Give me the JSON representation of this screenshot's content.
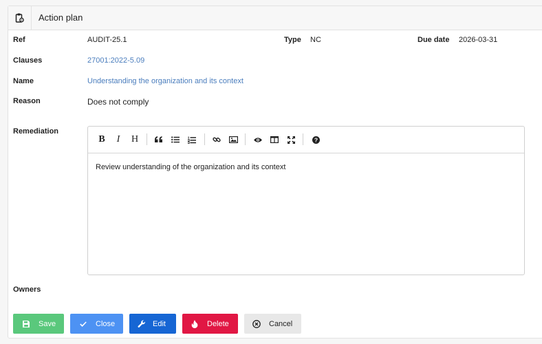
{
  "header": {
    "title": "Action plan",
    "icon": "clipboard-gear-icon"
  },
  "fields": {
    "ref_label": "Ref",
    "ref_value": "AUDIT-25.1",
    "type_label": "Type",
    "type_value": "NC",
    "due_label": "Due date",
    "due_value": "2026-03-31",
    "clauses_label": "Clauses",
    "clauses_value": "27001:2022-5.09",
    "name_label": "Name",
    "name_value": "Understanding the organization and its context",
    "reason_label": "Reason",
    "reason_value": "Does not comply",
    "remediation_label": "Remediation",
    "owners_label": "Owners"
  },
  "editor": {
    "content": "Review understanding of the organization and its context",
    "toolbar": {
      "bold": "B",
      "italic": "I",
      "heading": "H",
      "icons": [
        "quote-icon",
        "unordered-list-icon",
        "ordered-list-icon",
        "link-icon",
        "image-icon",
        "preview-eye-icon",
        "side-by-side-icon",
        "fullscreen-icon",
        "help-icon"
      ]
    }
  },
  "actions": {
    "save": "Save",
    "close": "Close",
    "edit": "Edit",
    "delete": "Delete",
    "cancel": "Cancel"
  },
  "colors": {
    "save": "#5ac87c",
    "close": "#4d92f3",
    "edit": "#1666d4",
    "delete": "#e11744",
    "cancel": "#e8e8e8",
    "link": "#4a7dbd"
  }
}
